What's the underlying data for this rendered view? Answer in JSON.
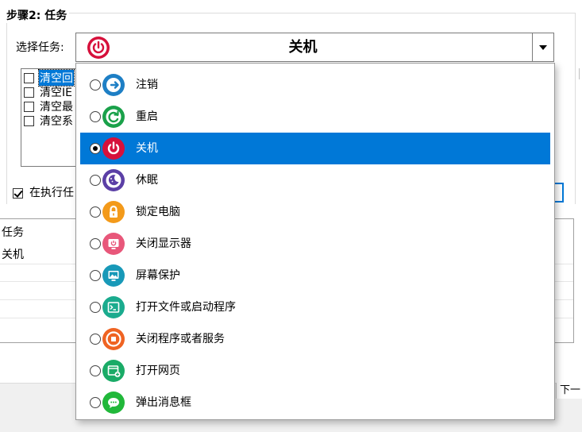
{
  "group": {
    "title": "步骤2: 任务"
  },
  "task_select": {
    "label": "选择任务:",
    "value": "关机",
    "icon": "power-icon",
    "value_color": "#d6103b"
  },
  "task_list": {
    "items": [
      {
        "label": "清空回",
        "checked": false,
        "selected": true
      },
      {
        "label": "清空IE",
        "checked": false,
        "selected": false
      },
      {
        "label": "清空最",
        "checked": false,
        "selected": false
      },
      {
        "label": "清空系",
        "checked": false,
        "selected": false
      }
    ]
  },
  "option": {
    "label": "在执行任",
    "checked": true
  },
  "table": {
    "rows": [
      "任务",
      "关机",
      "",
      "",
      ""
    ]
  },
  "footer": {
    "next_label": "下一"
  },
  "dropdown": {
    "items": [
      {
        "label": "注销",
        "icon": "logout-icon",
        "color": "#1e7fc5",
        "selected": false
      },
      {
        "label": "重启",
        "icon": "restart-icon",
        "color": "#1aa14a",
        "selected": false
      },
      {
        "label": "关机",
        "icon": "power-icon",
        "color": "#d6103b",
        "selected": true
      },
      {
        "label": "休眠",
        "icon": "sleep-icon",
        "color": "#5b3fa6",
        "selected": false
      },
      {
        "label": "锁定电脑",
        "icon": "lock-icon",
        "color": "#f39a1a",
        "selected": false
      },
      {
        "label": "关闭显示器",
        "icon": "monitor-off-icon",
        "color": "#e8577a",
        "selected": false
      },
      {
        "label": "屏幕保护",
        "icon": "screensaver-icon",
        "color": "#1899b8",
        "selected": false
      },
      {
        "label": "打开文件或启动程序",
        "icon": "terminal-icon",
        "color": "#1aab8e",
        "selected": false
      },
      {
        "label": "关闭程序或者服务",
        "icon": "stop-icon",
        "color": "#ef6322",
        "selected": false
      },
      {
        "label": "打开网页",
        "icon": "open-webpage-icon",
        "color": "#1aab67",
        "selected": false
      },
      {
        "label": "弹出消息框",
        "icon": "message-icon",
        "color": "#21b83a",
        "selected": false
      }
    ]
  }
}
